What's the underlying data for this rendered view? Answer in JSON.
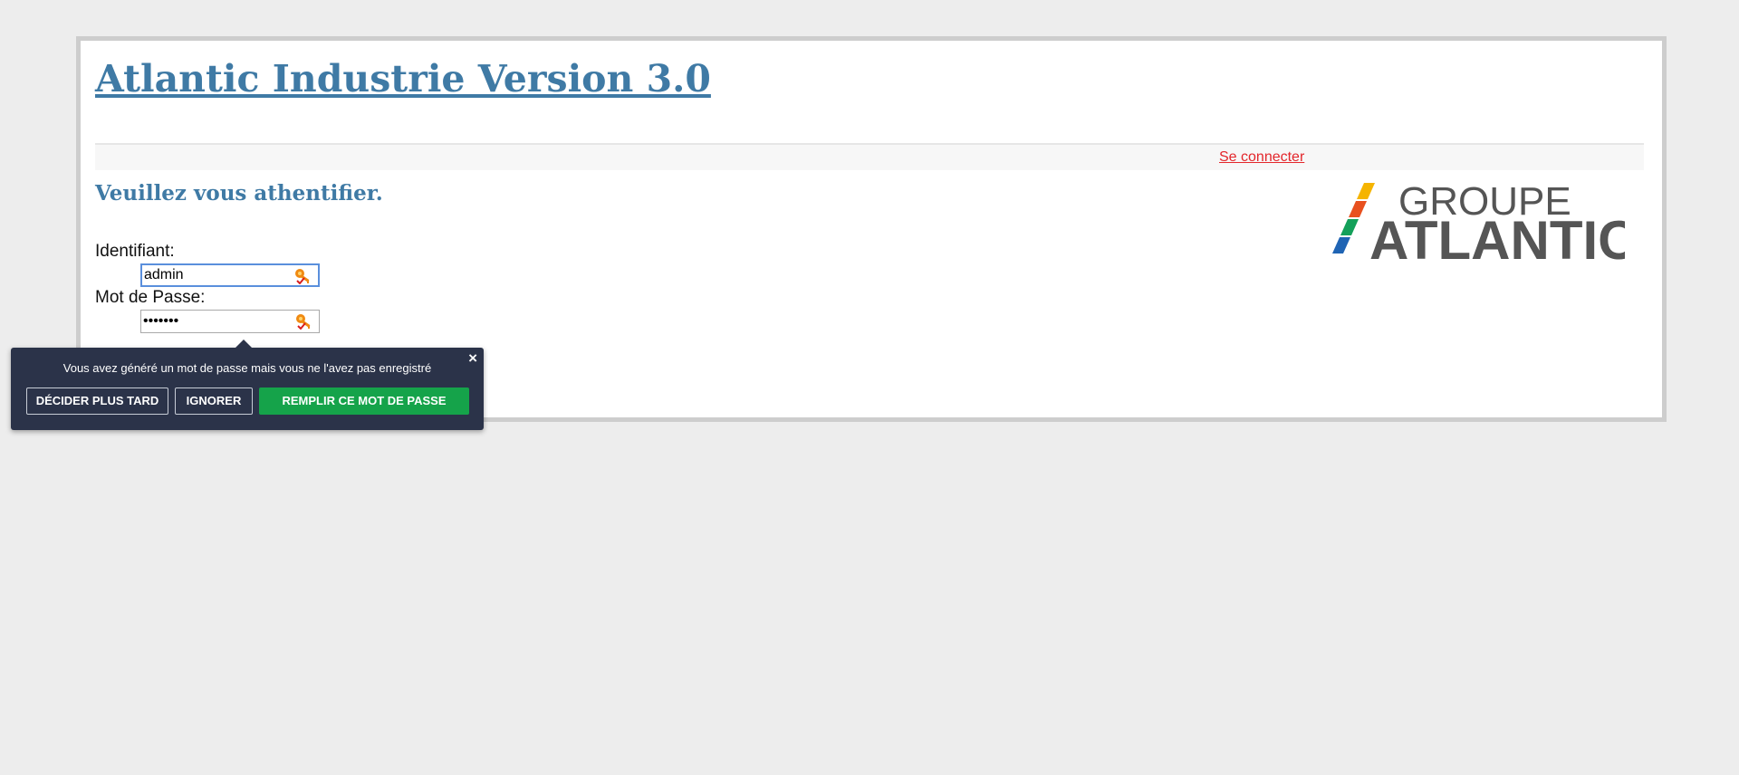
{
  "header": {
    "title": "Atlantic Industrie Version 3.0"
  },
  "nav": {
    "connect_label": "Se connecter"
  },
  "login": {
    "heading": "Veuillez vous athentifier.",
    "username_label": "Identifiant:",
    "username_value": "admin",
    "password_label": "Mot de Passe:",
    "password_value": "•••••••"
  },
  "logo": {
    "line1": "GROUPE",
    "line2": "ATLANTIC",
    "stripe_colors": [
      "#f5b400",
      "#e8501f",
      "#14a05a",
      "#1f64b4"
    ]
  },
  "password_popup": {
    "message": "Vous avez généré un mot de passe mais vous ne l'avez pas enregistré",
    "close_label": "×",
    "later_label": "DÉCIDER PLUS TARD",
    "ignore_label": "IGNORER",
    "fill_label": "REMPLIR CE MOT DE PASSE"
  },
  "colors": {
    "title_blue": "#3f7aa5",
    "link_red": "#e3262b",
    "popup_bg": "#2b3349",
    "fill_green": "#15a34a"
  }
}
